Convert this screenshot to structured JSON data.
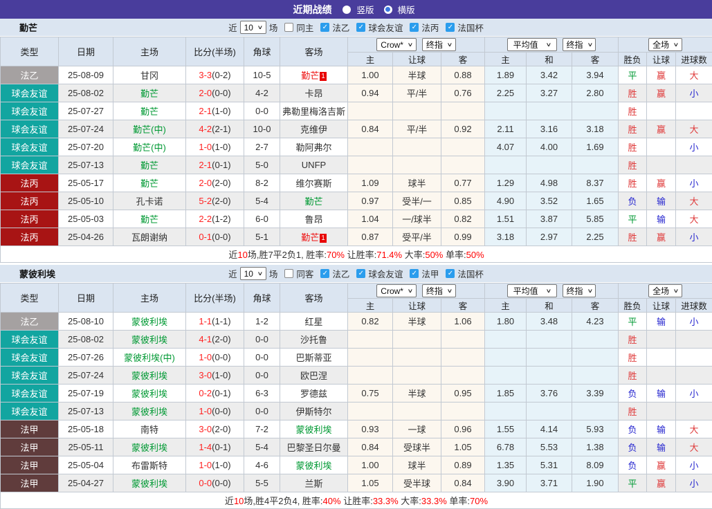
{
  "icons": {
    "chevron": "∨",
    "check": "✓"
  },
  "palette": {
    "header_purple": "#493d9c",
    "panel_blue": "#dbe5f1",
    "leagues": {
      "法乙": "#a5a1a1",
      "球会友谊": "#12a5a0",
      "法丙": "#a81414",
      "法甲": "#603c3c"
    },
    "result_colors": {
      "red": "#df3a3a",
      "blue": "#2626cf",
      "green": "#009933"
    },
    "team_colors": {
      "green": "#009933",
      "black": "#333333",
      "red": "#ee1111"
    },
    "odds_col_bg": "#fcf7ef",
    "avg_col_bg": "#e7f3f9"
  },
  "title_bar": {
    "title": "近期战绩",
    "vertical_label": "竖版",
    "horizontal_label": "横版"
  },
  "columns": {
    "type": "类型",
    "date": "日期",
    "home": "主场",
    "score": "比分(半场)",
    "corner": "角球",
    "away": "客场",
    "sub": [
      "主",
      "让球",
      "客",
      "主",
      "和",
      "客",
      "胜负",
      "让球",
      "进球数"
    ]
  },
  "teams": [
    {
      "name": "勤芒",
      "filter": {
        "near": "近",
        "count": "10",
        "games": "场",
        "same": "同主",
        "leagues": [
          "法乙",
          "球会友谊",
          "法丙",
          "法国杯"
        ]
      },
      "dropdowns": {
        "odds_source": "Crow*",
        "odds_stage": "终指",
        "avg_source": "平均值",
        "avg_stage": "终指",
        "scope": "全场"
      },
      "rows": [
        {
          "l": "法乙",
          "d": "25-08-09",
          "h": {
            "t": "甘冈",
            "c": "black"
          },
          "s": "3-3",
          "hf": "(0-2)",
          "cr": "10-5",
          "a": {
            "t": "勤芒",
            "c": "red",
            "b": "1"
          },
          "o": [
            "1.00",
            "半球",
            "0.88"
          ],
          "v": [
            "1.89",
            "3.42",
            "3.94"
          ],
          "r": [
            {
              "t": "平",
              "c": "green"
            },
            {
              "t": "赢",
              "c": "red"
            },
            {
              "t": "大",
              "c": "red"
            }
          ]
        },
        {
          "l": "球会友谊",
          "d": "25-08-02",
          "h": {
            "t": "勤芒",
            "c": "green"
          },
          "s": "2-0",
          "hf": "(0-0)",
          "cr": "4-2",
          "a": {
            "t": "卡昂",
            "c": "black"
          },
          "o": [
            "0.94",
            "平/半",
            "0.76"
          ],
          "v": [
            "2.25",
            "3.27",
            "2.80"
          ],
          "r": [
            {
              "t": "胜",
              "c": "red"
            },
            {
              "t": "赢",
              "c": "red"
            },
            {
              "t": "小",
              "c": "blue"
            }
          ]
        },
        {
          "l": "球会友谊",
          "d": "25-07-27",
          "h": {
            "t": "勤芒",
            "c": "green"
          },
          "s": "2-1",
          "hf": "(1-0)",
          "cr": "0-0",
          "a": {
            "t": "弗勒里梅洛吉斯",
            "c": "black"
          },
          "o": [
            "",
            "",
            ""
          ],
          "v": [
            "",
            "",
            ""
          ],
          "r": [
            {
              "t": "胜",
              "c": "red"
            },
            {
              "t": "",
              "c": ""
            },
            {
              "t": "",
              "c": ""
            }
          ]
        },
        {
          "l": "球会友谊",
          "d": "25-07-24",
          "h": {
            "t": "勤芒(中)",
            "c": "green"
          },
          "s": "4-2",
          "hf": "(2-1)",
          "cr": "10-0",
          "a": {
            "t": "克维伊",
            "c": "black"
          },
          "o": [
            "0.84",
            "平/半",
            "0.92"
          ],
          "v": [
            "2.11",
            "3.16",
            "3.18"
          ],
          "r": [
            {
              "t": "胜",
              "c": "red"
            },
            {
              "t": "赢",
              "c": "red"
            },
            {
              "t": "大",
              "c": "red"
            }
          ]
        },
        {
          "l": "球会友谊",
          "d": "25-07-20",
          "h": {
            "t": "勤芒(中)",
            "c": "green"
          },
          "s": "1-0",
          "hf": "(1-0)",
          "cr": "2-7",
          "a": {
            "t": "勒阿弗尔",
            "c": "black"
          },
          "o": [
            "",
            "",
            ""
          ],
          "v": [
            "4.07",
            "4.00",
            "1.69"
          ],
          "r": [
            {
              "t": "胜",
              "c": "red"
            },
            {
              "t": "",
              "c": ""
            },
            {
              "t": "小",
              "c": "blue"
            }
          ]
        },
        {
          "l": "球会友谊",
          "d": "25-07-13",
          "h": {
            "t": "勤芒",
            "c": "green"
          },
          "s": "2-1",
          "hf": "(0-1)",
          "cr": "5-0",
          "a": {
            "t": "UNFP",
            "c": "black"
          },
          "o": [
            "",
            "",
            ""
          ],
          "v": [
            "",
            "",
            ""
          ],
          "r": [
            {
              "t": "胜",
              "c": "red"
            },
            {
              "t": "",
              "c": ""
            },
            {
              "t": "",
              "c": ""
            }
          ]
        },
        {
          "l": "法丙",
          "d": "25-05-17",
          "h": {
            "t": "勤芒",
            "c": "green"
          },
          "s": "2-0",
          "hf": "(2-0)",
          "cr": "8-2",
          "a": {
            "t": "维尔赛斯",
            "c": "black"
          },
          "o": [
            "1.09",
            "球半",
            "0.77"
          ],
          "v": [
            "1.29",
            "4.98",
            "8.37"
          ],
          "r": [
            {
              "t": "胜",
              "c": "red"
            },
            {
              "t": "赢",
              "c": "red"
            },
            {
              "t": "小",
              "c": "blue"
            }
          ]
        },
        {
          "l": "法丙",
          "d": "25-05-10",
          "h": {
            "t": "孔卡诺",
            "c": "black"
          },
          "s": "5-2",
          "hf": "(2-0)",
          "cr": "5-4",
          "a": {
            "t": "勤芒",
            "c": "green"
          },
          "o": [
            "0.97",
            "受半/一",
            "0.85"
          ],
          "v": [
            "4.90",
            "3.52",
            "1.65"
          ],
          "r": [
            {
              "t": "负",
              "c": "blue"
            },
            {
              "t": "输",
              "c": "blue"
            },
            {
              "t": "大",
              "c": "red"
            }
          ]
        },
        {
          "l": "法丙",
          "d": "25-05-03",
          "h": {
            "t": "勤芒",
            "c": "green"
          },
          "s": "2-2",
          "hf": "(1-2)",
          "cr": "6-0",
          "a": {
            "t": "鲁昂",
            "c": "black"
          },
          "o": [
            "1.04",
            "一/球半",
            "0.82"
          ],
          "v": [
            "1.51",
            "3.87",
            "5.85"
          ],
          "r": [
            {
              "t": "平",
              "c": "green"
            },
            {
              "t": "输",
              "c": "blue"
            },
            {
              "t": "大",
              "c": "red"
            }
          ]
        },
        {
          "l": "法丙",
          "d": "25-04-26",
          "h": {
            "t": "瓦朗谢纳",
            "c": "black"
          },
          "s": "0-1",
          "hf": "(0-0)",
          "cr": "5-1",
          "a": {
            "t": "勤芒",
            "c": "red",
            "b": "1"
          },
          "o": [
            "0.87",
            "受平/半",
            "0.99"
          ],
          "v": [
            "3.18",
            "2.97",
            "2.25"
          ],
          "r": [
            {
              "t": "胜",
              "c": "red"
            },
            {
              "t": "赢",
              "c": "red"
            },
            {
              "t": "小",
              "c": "blue"
            }
          ]
        }
      ],
      "summary": [
        {
          "t": "近"
        },
        {
          "t": "10",
          "c": "red"
        },
        {
          "t": "场,胜7平2负1, 胜率:"
        },
        {
          "t": "70%",
          "c": "red"
        },
        {
          "t": " 让胜率:"
        },
        {
          "t": "71.4%",
          "c": "red"
        },
        {
          "t": " 大率:"
        },
        {
          "t": "50%",
          "c": "red"
        },
        {
          "t": " 单率:"
        },
        {
          "t": "50%",
          "c": "red"
        }
      ]
    },
    {
      "name": "蒙彼利埃",
      "filter": {
        "near": "近",
        "count": "10",
        "games": "场",
        "same": "同客",
        "leagues": [
          "法乙",
          "球会友谊",
          "法甲",
          "法国杯"
        ]
      },
      "dropdowns": {
        "odds_source": "Crow*",
        "odds_stage": "终指",
        "avg_source": "平均值",
        "avg_stage": "终指",
        "scope": "全场"
      },
      "rows": [
        {
          "l": "法乙",
          "d": "25-08-10",
          "h": {
            "t": "蒙彼利埃",
            "c": "green"
          },
          "s": "1-1",
          "hf": "(1-1)",
          "cr": "1-2",
          "a": {
            "t": "红星",
            "c": "black"
          },
          "o": [
            "0.82",
            "半球",
            "1.06"
          ],
          "v": [
            "1.80",
            "3.48",
            "4.23"
          ],
          "r": [
            {
              "t": "平",
              "c": "green"
            },
            {
              "t": "输",
              "c": "blue"
            },
            {
              "t": "小",
              "c": "blue"
            }
          ]
        },
        {
          "l": "球会友谊",
          "d": "25-08-02",
          "h": {
            "t": "蒙彼利埃",
            "c": "green"
          },
          "s": "4-1",
          "hf": "(2-0)",
          "cr": "0-0",
          "a": {
            "t": "沙托鲁",
            "c": "black"
          },
          "o": [
            "",
            "",
            ""
          ],
          "v": [
            "",
            "",
            ""
          ],
          "r": [
            {
              "t": "胜",
              "c": "red"
            },
            {
              "t": "",
              "c": ""
            },
            {
              "t": "",
              "c": ""
            }
          ]
        },
        {
          "l": "球会友谊",
          "d": "25-07-26",
          "h": {
            "t": "蒙彼利埃(中)",
            "c": "green"
          },
          "s": "1-0",
          "hf": "(0-0)",
          "cr": "0-0",
          "a": {
            "t": "巴斯蒂亚",
            "c": "black"
          },
          "o": [
            "",
            "",
            ""
          ],
          "v": [
            "",
            "",
            ""
          ],
          "r": [
            {
              "t": "胜",
              "c": "red"
            },
            {
              "t": "",
              "c": ""
            },
            {
              "t": "",
              "c": ""
            }
          ]
        },
        {
          "l": "球会友谊",
          "d": "25-07-24",
          "h": {
            "t": "蒙彼利埃",
            "c": "green"
          },
          "s": "3-0",
          "hf": "(1-0)",
          "cr": "0-0",
          "a": {
            "t": "欧巴涅",
            "c": "black"
          },
          "o": [
            "",
            "",
            ""
          ],
          "v": [
            "",
            "",
            ""
          ],
          "r": [
            {
              "t": "胜",
              "c": "red"
            },
            {
              "t": "",
              "c": ""
            },
            {
              "t": "",
              "c": ""
            }
          ]
        },
        {
          "l": "球会友谊",
          "d": "25-07-19",
          "h": {
            "t": "蒙彼利埃",
            "c": "green"
          },
          "s": "0-2",
          "hf": "(0-1)",
          "cr": "6-3",
          "a": {
            "t": "罗德兹",
            "c": "black"
          },
          "o": [
            "0.75",
            "半球",
            "0.95"
          ],
          "v": [
            "1.85",
            "3.76",
            "3.39"
          ],
          "r": [
            {
              "t": "负",
              "c": "blue"
            },
            {
              "t": "输",
              "c": "blue"
            },
            {
              "t": "小",
              "c": "blue"
            }
          ]
        },
        {
          "l": "球会友谊",
          "d": "25-07-13",
          "h": {
            "t": "蒙彼利埃",
            "c": "green"
          },
          "s": "1-0",
          "hf": "(0-0)",
          "cr": "0-0",
          "a": {
            "t": "伊斯特尔",
            "c": "black"
          },
          "o": [
            "",
            "",
            ""
          ],
          "v": [
            "",
            "",
            ""
          ],
          "r": [
            {
              "t": "胜",
              "c": "red"
            },
            {
              "t": "",
              "c": ""
            },
            {
              "t": "",
              "c": ""
            }
          ]
        },
        {
          "l": "法甲",
          "d": "25-05-18",
          "h": {
            "t": "南特",
            "c": "black"
          },
          "s": "3-0",
          "hf": "(2-0)",
          "cr": "7-2",
          "a": {
            "t": "蒙彼利埃",
            "c": "green"
          },
          "o": [
            "0.93",
            "一球",
            "0.96"
          ],
          "v": [
            "1.55",
            "4.14",
            "5.93"
          ],
          "r": [
            {
              "t": "负",
              "c": "blue"
            },
            {
              "t": "输",
              "c": "blue"
            },
            {
              "t": "大",
              "c": "red"
            }
          ]
        },
        {
          "l": "法甲",
          "d": "25-05-11",
          "h": {
            "t": "蒙彼利埃",
            "c": "green"
          },
          "s": "1-4",
          "hf": "(0-1)",
          "cr": "5-4",
          "a": {
            "t": "巴黎圣日尔曼",
            "c": "black"
          },
          "o": [
            "0.84",
            "受球半",
            "1.05"
          ],
          "v": [
            "6.78",
            "5.53",
            "1.38"
          ],
          "r": [
            {
              "t": "负",
              "c": "blue"
            },
            {
              "t": "输",
              "c": "blue"
            },
            {
              "t": "大",
              "c": "red"
            }
          ]
        },
        {
          "l": "法甲",
          "d": "25-05-04",
          "h": {
            "t": "布雷斯特",
            "c": "black"
          },
          "s": "1-0",
          "hf": "(1-0)",
          "cr": "4-6",
          "a": {
            "t": "蒙彼利埃",
            "c": "green"
          },
          "o": [
            "1.00",
            "球半",
            "0.89"
          ],
          "v": [
            "1.35",
            "5.31",
            "8.09"
          ],
          "r": [
            {
              "t": "负",
              "c": "blue"
            },
            {
              "t": "赢",
              "c": "red"
            },
            {
              "t": "小",
              "c": "blue"
            }
          ]
        },
        {
          "l": "法甲",
          "d": "25-04-27",
          "h": {
            "t": "蒙彼利埃",
            "c": "green"
          },
          "s": "0-0",
          "hf": "(0-0)",
          "cr": "5-5",
          "a": {
            "t": "兰斯",
            "c": "black"
          },
          "o": [
            "1.05",
            "受半球",
            "0.84"
          ],
          "v": [
            "3.90",
            "3.71",
            "1.90"
          ],
          "r": [
            {
              "t": "平",
              "c": "green"
            },
            {
              "t": "赢",
              "c": "red"
            },
            {
              "t": "小",
              "c": "blue"
            }
          ]
        }
      ],
      "summary": [
        {
          "t": "近"
        },
        {
          "t": "10",
          "c": "red"
        },
        {
          "t": "场,胜4平2负4, 胜率:"
        },
        {
          "t": "40%",
          "c": "red"
        },
        {
          "t": " 让胜率:"
        },
        {
          "t": "33.3%",
          "c": "red"
        },
        {
          "t": " 大率:"
        },
        {
          "t": "33.3%",
          "c": "red"
        },
        {
          "t": " 单率:"
        },
        {
          "t": "70%",
          "c": "red"
        }
      ]
    }
  ]
}
